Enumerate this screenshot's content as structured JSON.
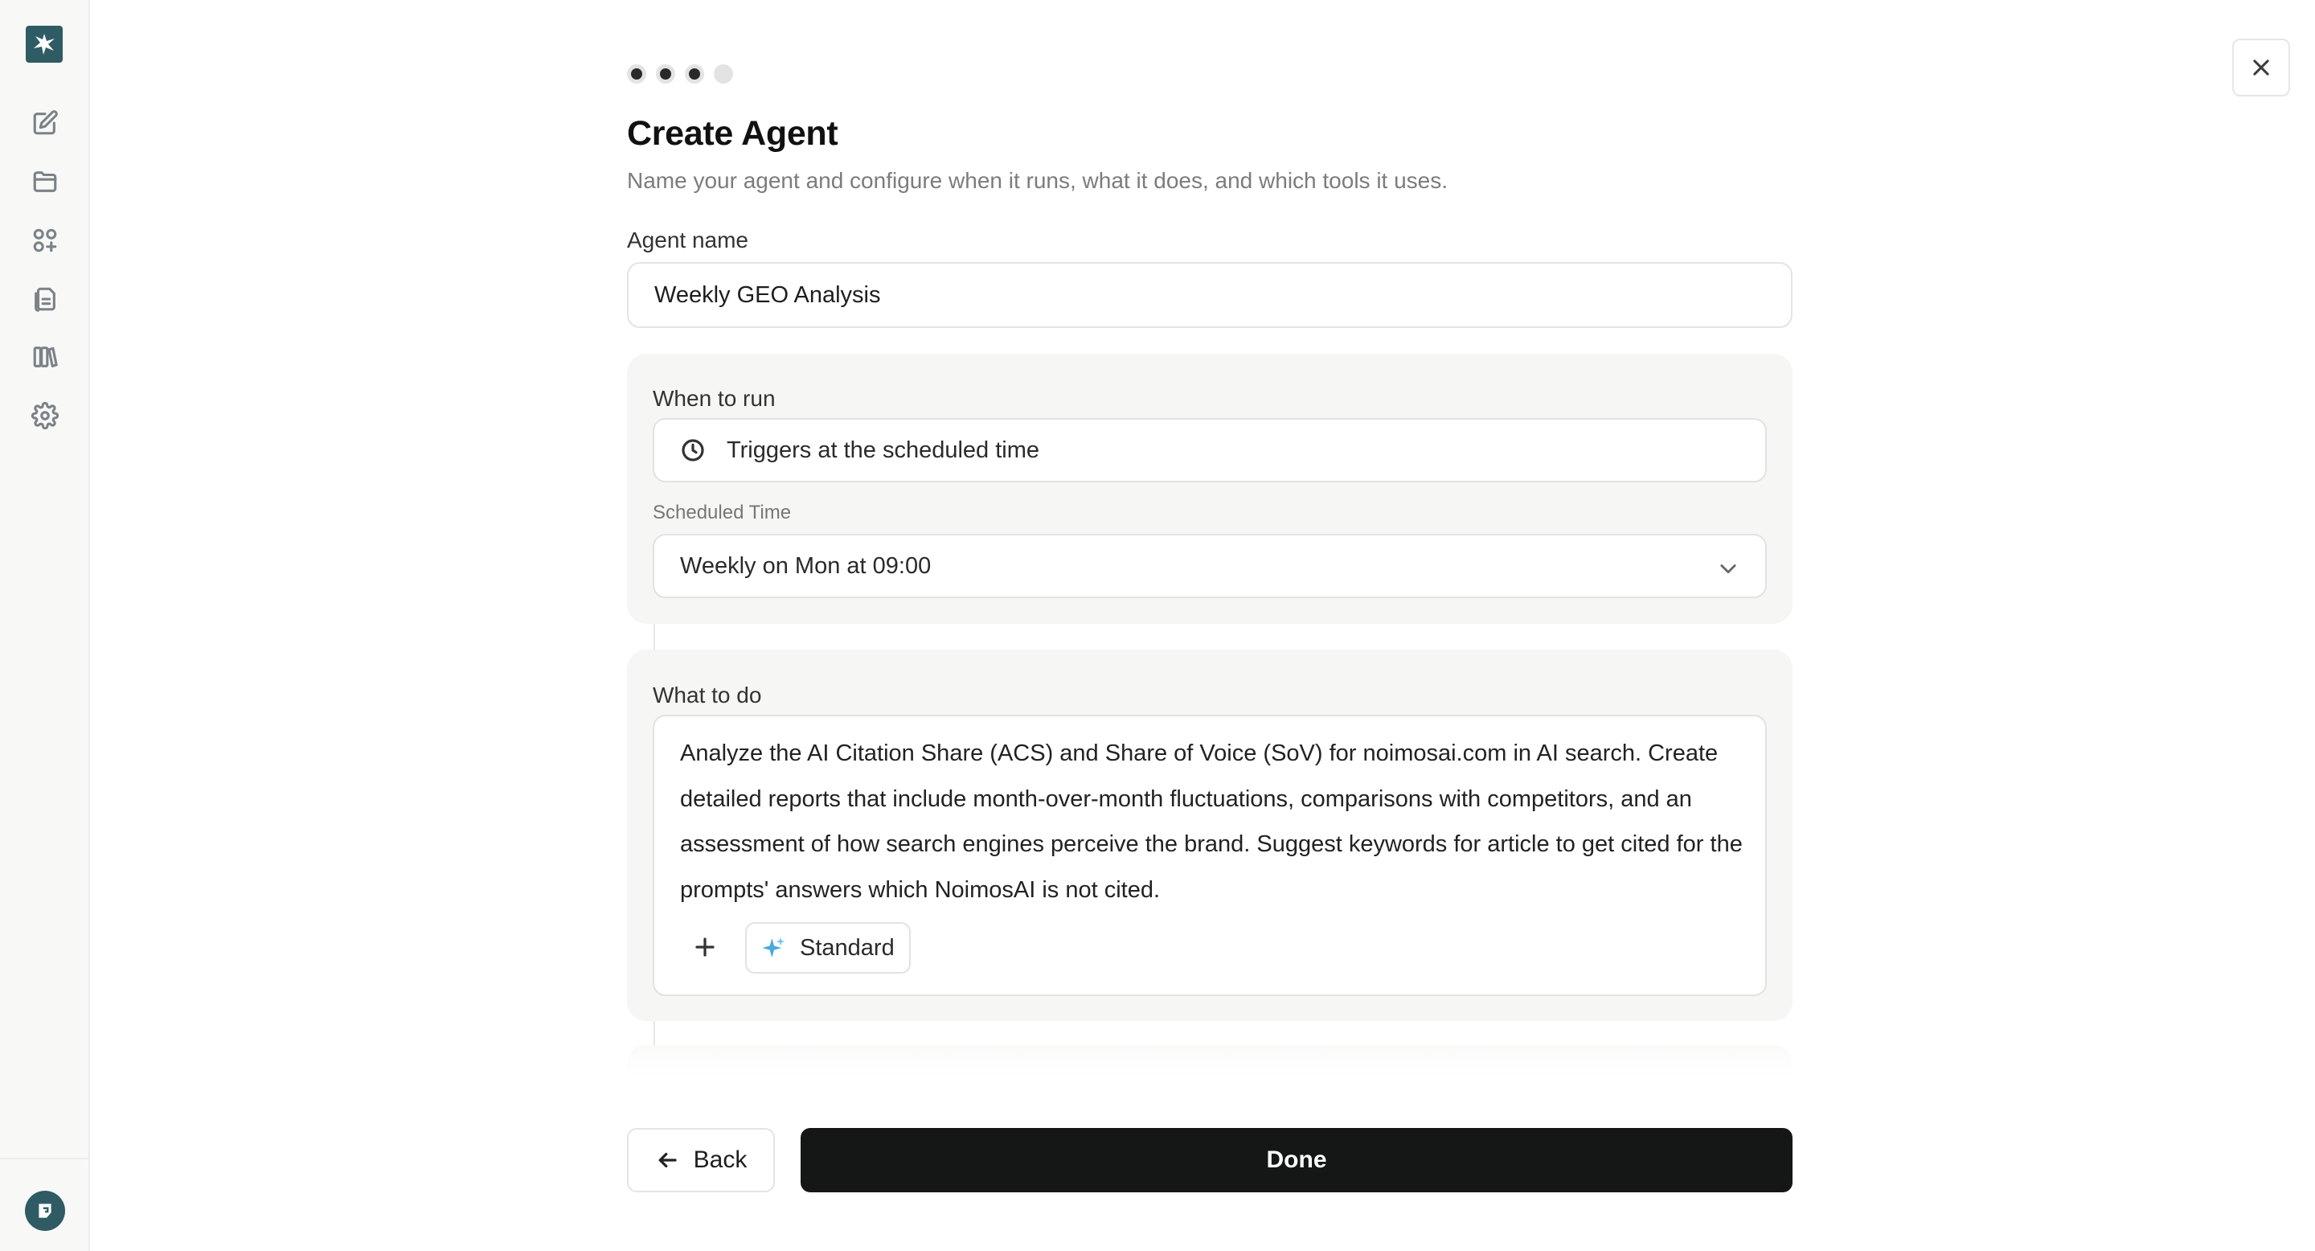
{
  "sidebar": {
    "logo_icon": "starburst-logo-icon",
    "items": [
      {
        "icon": "edit-icon"
      },
      {
        "icon": "folder-icon"
      },
      {
        "icon": "apps-add-icon"
      },
      {
        "icon": "documents-icon"
      },
      {
        "icon": "library-icon"
      },
      {
        "icon": "gear-icon"
      }
    ],
    "avatar_icon": "user-avatar-icon"
  },
  "close": {
    "icon": "close-icon"
  },
  "steps": {
    "total": 4,
    "completed": 3
  },
  "header": {
    "title": "Create Agent",
    "subtitle": "Name your agent and configure when it runs, what it does, and which tools it uses."
  },
  "agent_name": {
    "label": "Agent name",
    "value": "Weekly GEO Analysis"
  },
  "when_to_run": {
    "label": "When to run",
    "trigger": "Triggers at the scheduled time",
    "trigger_icon": "clock-icon",
    "schedule_label": "Scheduled Time",
    "schedule_value": "Weekly on Mon at 09:00"
  },
  "what_to_do": {
    "label": "What to do",
    "prompt": "Analyze the AI Citation Share (ACS) and Share of Voice (SoV) for noimosai.com in AI search. Create detailed reports that include month-over-month fluctuations, comparisons with competitors, and an assessment of how search engines perceive the brand. Suggest keywords for article to get cited for the prompts' answers which NoimosAI is not cited.",
    "mode_label": "Standard",
    "mode_icon": "sparkle-icon",
    "add_icon": "plus-icon"
  },
  "footer": {
    "back_label": "Back",
    "done_label": "Done"
  },
  "colors": {
    "brand": "#2f5c64",
    "primary_button": "#151616",
    "sparkle": "#4aa8e0"
  }
}
